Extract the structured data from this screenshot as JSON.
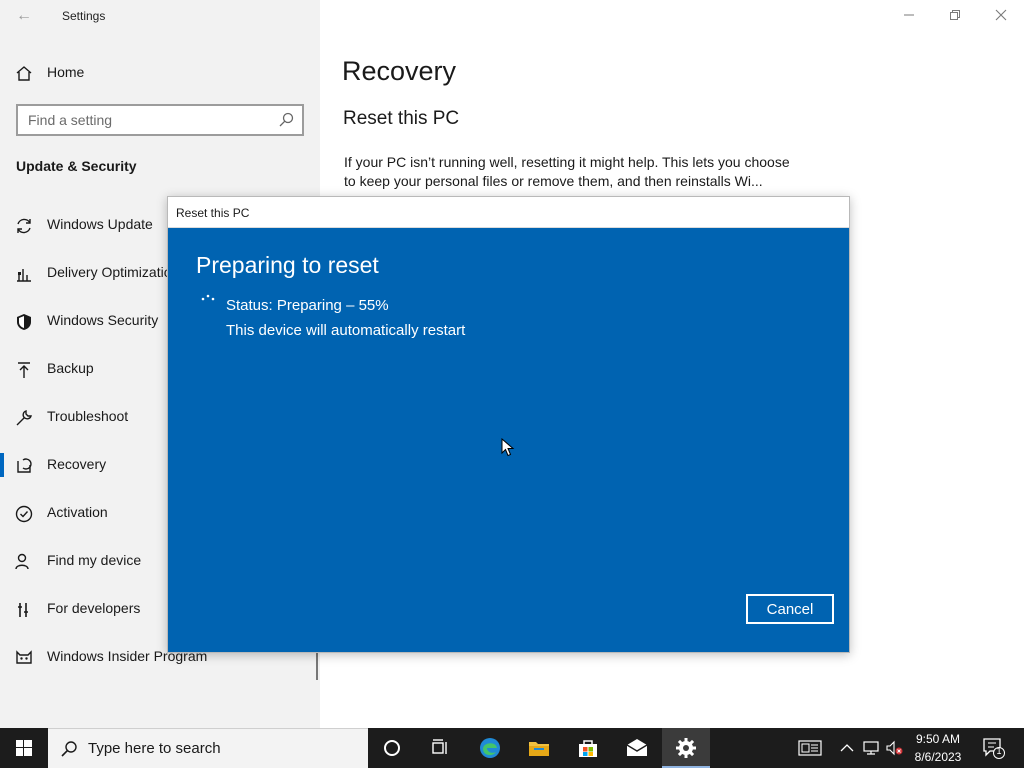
{
  "window": {
    "app_title": "Settings",
    "back_icon": "back-arrow-icon",
    "controls": {
      "minimize": "minimize-icon",
      "maximize": "restore-icon",
      "close": "close-icon"
    }
  },
  "sidebar": {
    "home_label": "Home",
    "search_placeholder": "Find a setting",
    "section_header": "Update & Security",
    "items": [
      {
        "label": "Windows Update",
        "icon": "sync-icon"
      },
      {
        "label": "Delivery Optimization",
        "icon": "delivery-optimization-icon"
      },
      {
        "label": "Windows Security",
        "icon": "shield-icon"
      },
      {
        "label": "Backup",
        "icon": "backup-arrow-icon"
      },
      {
        "label": "Troubleshoot",
        "icon": "wrench-icon"
      },
      {
        "label": "Recovery",
        "icon": "recovery-icon",
        "selected": true
      },
      {
        "label": "Activation",
        "icon": "checkmark-circle-icon"
      },
      {
        "label": "Find my device",
        "icon": "person-pin-icon"
      },
      {
        "label": "For developers",
        "icon": "developer-tools-icon"
      },
      {
        "label": "Windows Insider Program",
        "icon": "insider-cat-icon"
      }
    ]
  },
  "main": {
    "title": "Recovery",
    "section_title": "Reset this PC",
    "description": "If your PC isn’t running well, resetting it might help. This lets you choose to keep your personal files or remove them, and then reinstalls Wi..."
  },
  "dialog": {
    "title": "Reset this PC",
    "heading": "Preparing to reset",
    "status": "Status: Preparing – 55%",
    "progress_percent": 55,
    "restart_note": "This device will automatically restart",
    "cancel_label": "Cancel",
    "background_color": "#0063b1"
  },
  "taskbar": {
    "search_placeholder": "Type here to search",
    "pinned": [
      "cortana-icon",
      "task-view-icon",
      "edge-icon",
      "file-explorer-icon",
      "store-icon",
      "mail-icon",
      "settings-gear-icon"
    ],
    "time": "9:50 AM",
    "date": "8/6/2023",
    "notification_count": "1"
  },
  "colors": {
    "accent": "#0067c0",
    "dialog_blue": "#0063b1",
    "taskbar": "#1c1c1c"
  }
}
